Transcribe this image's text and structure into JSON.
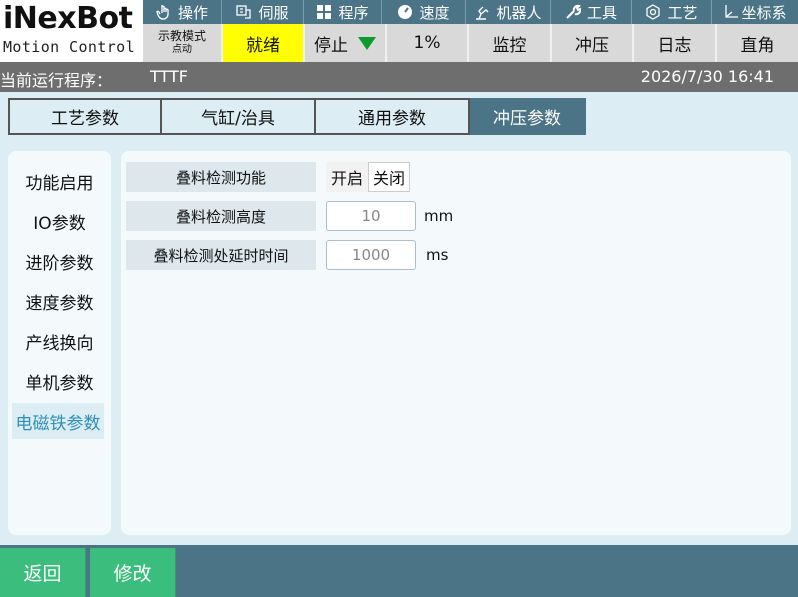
{
  "logo": {
    "brand": "iNexBot",
    "tagline": "Motion Control"
  },
  "topnav": [
    {
      "label": "操作",
      "icon": "hand-pointer-icon"
    },
    {
      "label": "伺服",
      "icon": "servo-icon"
    },
    {
      "label": "程序",
      "icon": "program-grid-icon"
    },
    {
      "label": "速度",
      "icon": "speed-gauge-icon"
    },
    {
      "label": "机器人",
      "icon": "robot-arm-icon"
    },
    {
      "label": "工具",
      "icon": "wrench-icon"
    },
    {
      "label": "工艺",
      "icon": "process-icon"
    },
    {
      "label": "坐标系",
      "icon": "coordinate-axes-icon"
    }
  ],
  "status": {
    "mode": "示教模式",
    "mode_sub": "点动",
    "state": "就绪",
    "run": "停止",
    "speed": "1%",
    "monitor": "监控",
    "punch": "冲压",
    "log": "日志",
    "coord": "直角",
    "state_color": "#ffff00",
    "run_indicator_color": "#0f9a2e"
  },
  "program_bar": {
    "label": "当前运行程序：",
    "name": "TTTF",
    "datetime": "2026/7/30 16:41"
  },
  "tabs": [
    {
      "label": "工艺参数",
      "active": false
    },
    {
      "label": "气缸/治具",
      "active": false
    },
    {
      "label": "通用参数",
      "active": false
    },
    {
      "label": "冲压参数",
      "active": true
    }
  ],
  "side_menu": [
    {
      "label": "功能启用",
      "active": false
    },
    {
      "label": "IO参数",
      "active": false
    },
    {
      "label": "进阶参数",
      "active": false
    },
    {
      "label": "速度参数",
      "active": false
    },
    {
      "label": "产线换向",
      "active": false
    },
    {
      "label": "单机参数",
      "active": false
    },
    {
      "label": "电磁铁参数",
      "active": true
    }
  ],
  "params": {
    "stack_detect": {
      "label": "叠料检测功能",
      "on_label": "开启",
      "off_label": "关闭",
      "value": "开启"
    },
    "stack_height": {
      "label": "叠料检测高度",
      "value": "10",
      "unit": "mm"
    },
    "stack_delay": {
      "label": "叠料检测处延时时间",
      "value": "1000",
      "unit": "ms"
    }
  },
  "footer": {
    "back": "返回",
    "modify": "修改"
  },
  "colors": {
    "header_bg": "#4b7587",
    "page_bg": "#dcedf3",
    "panel_bg": "#f4fafc",
    "footer_button": "#3bbd7d",
    "active_side_text": "#2f8fb8"
  }
}
